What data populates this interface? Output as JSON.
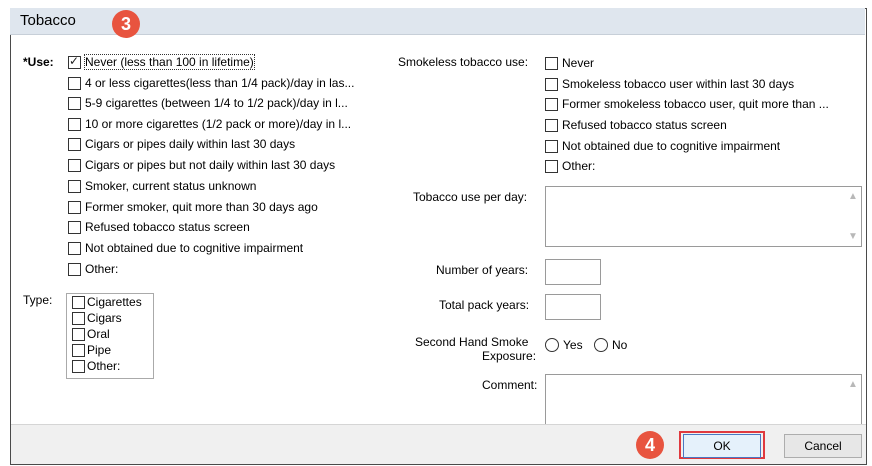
{
  "window": {
    "title": "Tobacco"
  },
  "markers": {
    "step3": "3",
    "step4": "4"
  },
  "use": {
    "label": "*Use:",
    "options": [
      {
        "label": "Never (less than 100 in lifetime)",
        "checked": true
      },
      {
        "label": "4 or less cigarettes(less than 1/4 pack)/day in las...",
        "checked": false
      },
      {
        "label": "5-9 cigarettes (between 1/4 to 1/2 pack)/day in l...",
        "checked": false
      },
      {
        "label": "10 or more cigarettes (1/2 pack or more)/day in l...",
        "checked": false
      },
      {
        "label": "Cigars or pipes daily within last 30 days",
        "checked": false
      },
      {
        "label": "Cigars or pipes but not daily within last 30 days",
        "checked": false
      },
      {
        "label": "Smoker, current status unknown",
        "checked": false
      },
      {
        "label": "Former smoker, quit more than 30 days ago",
        "checked": false
      },
      {
        "label": "Refused tobacco status screen",
        "checked": false
      },
      {
        "label": "Not obtained due to cognitive impairment",
        "checked": false
      },
      {
        "label": "Other:",
        "checked": false
      }
    ]
  },
  "type": {
    "label": "Type:",
    "options": [
      "Cigarettes",
      "Cigars",
      "Oral",
      "Pipe",
      "Other:"
    ]
  },
  "smokeless": {
    "label": "Smokeless tobacco use:",
    "options": [
      "Never",
      "Smokeless tobacco user within last 30 days",
      "Former smokeless tobacco user, quit more than ...",
      "Refused tobacco status screen",
      "Not obtained due to cognitive impairment",
      "Other:"
    ]
  },
  "fields": {
    "per_day_label": "Tobacco use per day:",
    "years_label": "Number of years:",
    "pack_years_label": "Total pack years:",
    "second_hand_label_1": "Second Hand Smoke",
    "second_hand_label_2": "Exposure:",
    "yes": "Yes",
    "no": "No",
    "comment_label": "Comment:"
  },
  "buttons": {
    "ok": "OK",
    "cancel": "Cancel"
  },
  "colors": {
    "marker": "#e8543f",
    "highlight_border": "#e0393e",
    "titlebar": "#dfe6ee"
  }
}
